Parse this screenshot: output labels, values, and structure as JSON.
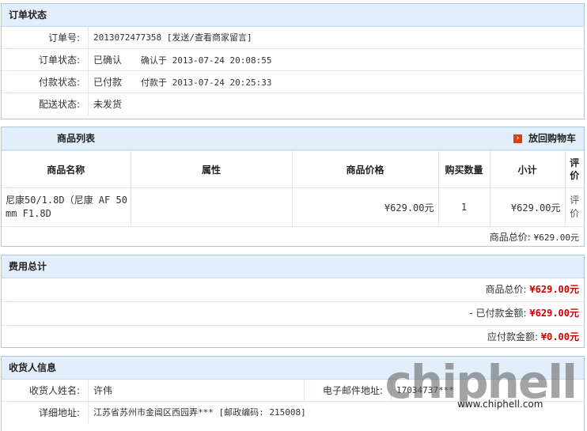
{
  "order_status": {
    "title": "订单状态",
    "rows": [
      {
        "label": "订单号:",
        "value": "2013072477358 [发送/查看商家留言]"
      },
      {
        "label": "订单状态:",
        "value": "已确认",
        "extra": "确认于 2013-07-24 20:08:55"
      },
      {
        "label": "付款状态:",
        "value": "已付款",
        "extra": "付款于 2013-07-24 20:25:33"
      },
      {
        "label": "配送状态:",
        "value": "未发货"
      }
    ]
  },
  "products": {
    "title": "商品列表",
    "cart_link": "放回购物车",
    "headers": [
      "商品名称",
      "属性",
      "商品价格",
      "购买数量",
      "小计",
      "评价"
    ],
    "rows": [
      {
        "name": "尼康50/1.8D（尼康 AF 50mm F1.8D",
        "attr": "",
        "price": "¥629.00元",
        "qty": "1",
        "subtotal": "¥629.00元",
        "review": "评价"
      }
    ],
    "total_label": "商品总价:",
    "total_value": "¥629.00元"
  },
  "fees": {
    "title": "费用总计",
    "rows": [
      {
        "label": "商品总价:",
        "value": "¥629.00元"
      },
      {
        "label": "- 已付款金额:",
        "value": "¥629.00元"
      },
      {
        "label": "应付款金额:",
        "value": "¥0.00元"
      }
    ]
  },
  "consignee": {
    "title": "收货人信息",
    "name_label": "收货人姓名:",
    "name_value": "许伟",
    "email_label": "电子邮件地址:",
    "email_value": "17034737***",
    "address_label": "详细地址:",
    "address_value": "江苏省苏州市金阊区西园弄*** [邮政编码: 215008]"
  },
  "watermark": {
    "logo": "chiphell",
    "url": "www.chiphell.com"
  },
  "colors": {
    "header_bg": "#e2eef9",
    "border": "#a9c6e3",
    "price_red": "#cc0000",
    "arrow": "#d9400f"
  }
}
